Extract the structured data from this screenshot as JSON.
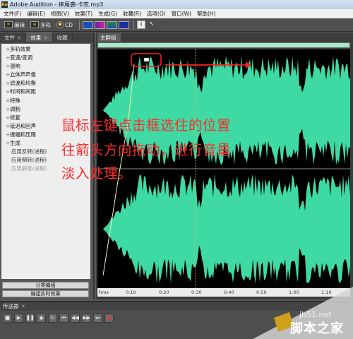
{
  "window": {
    "title": "Adobe Audition - 摔尾袭-卡农.mp3",
    "app_icon": "Au"
  },
  "menu": [
    "文件(F)",
    "编辑(E)",
    "视图(V)",
    "效果(T)",
    "生成(G)",
    "收藏(R)",
    "选项(O)",
    "窗口(W)",
    "帮助(H)"
  ],
  "toolbar": {
    "edit_label": "编辑",
    "multitrack_label": "多轨",
    "cd_label": "CD"
  },
  "panel": {
    "tabs": [
      "文件",
      "效果",
      "收藏"
    ],
    "items": [
      {
        "label": "多轨效果"
      },
      {
        "label": "变速/变调"
      },
      {
        "label": "混响"
      },
      {
        "label": "立体声声像"
      },
      {
        "label": "滤波和均衡"
      },
      {
        "label": "时间和间距"
      },
      {
        "label": "特殊"
      },
      {
        "label": "调制"
      },
      {
        "label": "修复"
      },
      {
        "label": "延迟和回声"
      },
      {
        "label": "振幅和压限"
      },
      {
        "label": "生成"
      },
      {
        "label": "应用反转(进程)"
      },
      {
        "label": "应用倒转(进程)"
      },
      {
        "label": "应用静音(进程)"
      }
    ],
    "btn_group": "分类编组",
    "btn_realtime": "编组实时效果"
  },
  "editor": {
    "tab": "主群组",
    "ruler_unit": "hms",
    "ticks": [
      "0:10",
      "0:20",
      "0:30",
      "0:40",
      "0:50",
      "1:00",
      "1:10"
    ],
    "wave_color": "#3fd9a4"
  },
  "annotation": [
    "鼠标左键点击框选住的位置",
    "往箭头方向拖动，进行音量",
    "淡入处理。"
  ],
  "transport": {
    "title": "传送器"
  },
  "watermark": {
    "url": "jb51.net",
    "name": "脚本之家"
  }
}
